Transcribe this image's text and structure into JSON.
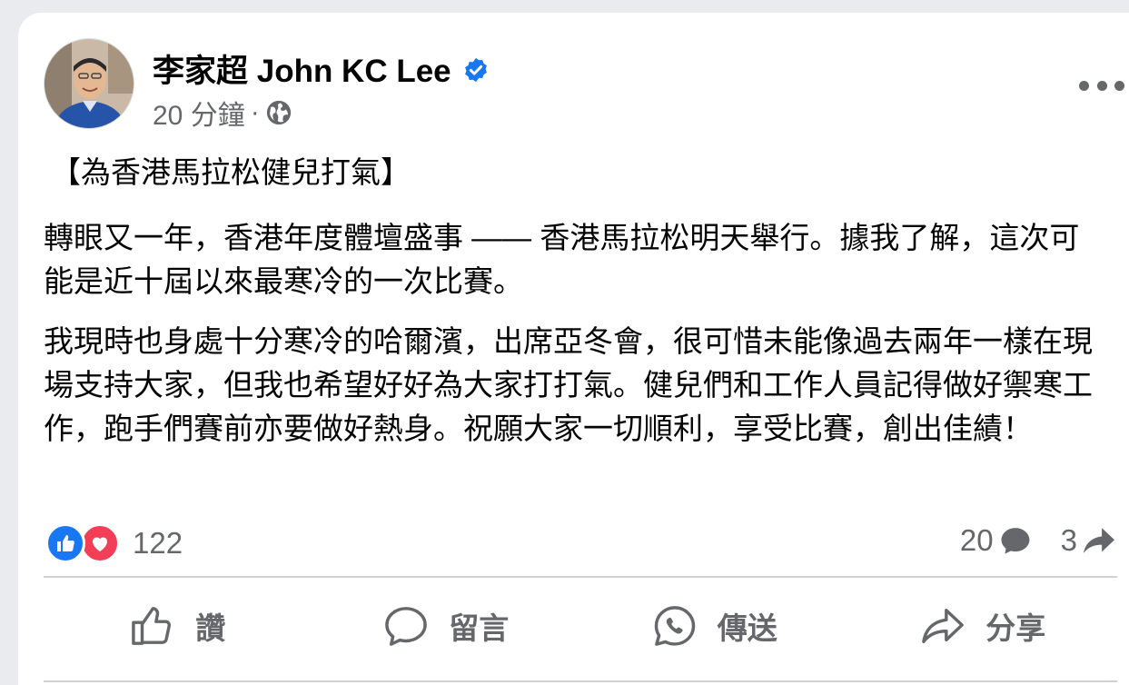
{
  "post": {
    "author": "李家超 John KC Lee",
    "verified_icon": "verified-badge-icon",
    "time": "20 分鐘",
    "separator": "·",
    "audience_icon": "globe-icon",
    "title": "【為香港馬拉松健兒打氣】",
    "paragraphs": [
      "轉眼又一年，香港年度體壇盛事 —— 香港馬拉松明天舉行。據我了解，這次可能是近十屆以來最寒冷的一次比賽。",
      "我現時也身處十分寒冷的哈爾濱，出席亞冬會，很可惜未能像過去兩年一樣在現場支持大家，但我也希望好好為大家打打氣。健兒們和工作人員記得做好禦寒工作，跑手們賽前亦要做好熱身。祝願大家一切順利，享受比賽，創出佳績！"
    ]
  },
  "stats": {
    "reaction_count": "122",
    "comment_count": "20",
    "share_count": "3"
  },
  "actions": {
    "like_label": "讚",
    "comment_label": "留言",
    "send_label": "傳送",
    "share_label": "分享"
  },
  "colors": {
    "accent": "#1877f2",
    "love": "#f33e58",
    "secondary_text": "#65676b"
  }
}
